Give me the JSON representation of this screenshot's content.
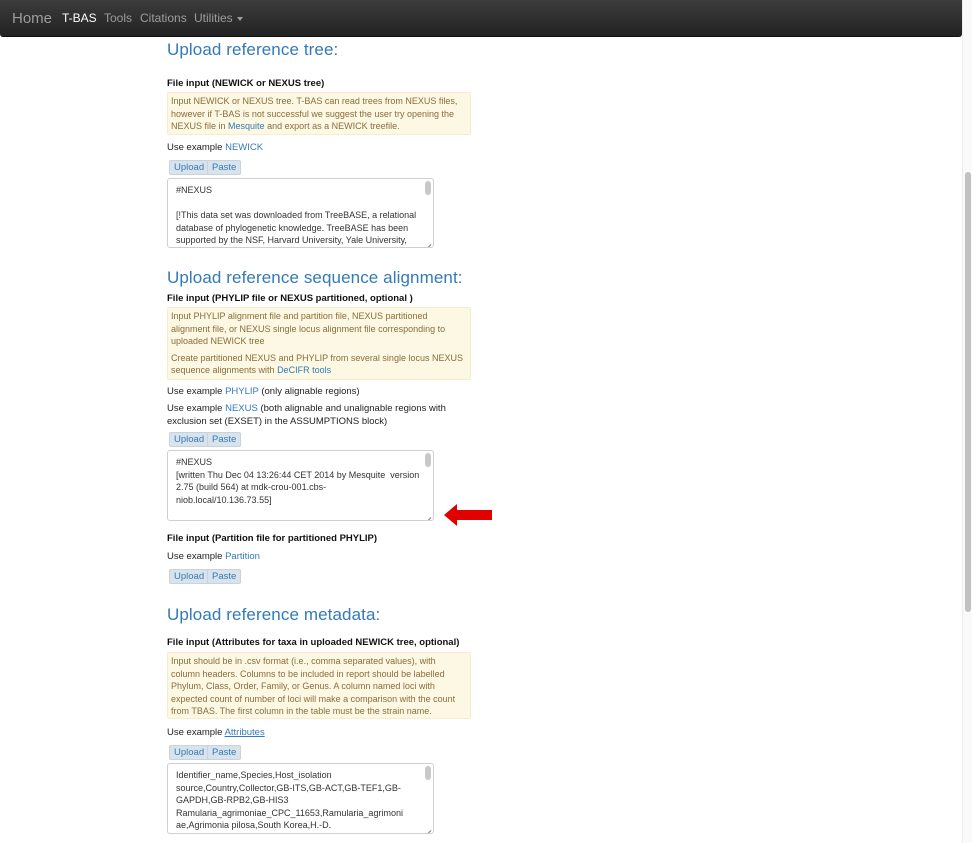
{
  "navbar": {
    "brand": "Home",
    "items": [
      {
        "label": "T-BAS",
        "active": true
      },
      {
        "label": "Tools"
      },
      {
        "label": "Citations"
      },
      {
        "label": "Utilities"
      }
    ]
  },
  "tree": {
    "heading": "Upload reference tree:",
    "label": "File input (NEWICK or NEXUS tree)",
    "note_before_link": "Input NEWICK or NEXUS tree. T-BAS can read trees from NEXUS files, however if T-BAS is not successful we suggest the user try opening the NEXUS file in ",
    "note_link": "Mesquite",
    "note_after_link": " and export as a NEWICK treefile.",
    "example_prefix": "Use example ",
    "example_link": "NEWICK",
    "upload": "Upload",
    "paste": "Paste",
    "textarea": "#NEXUS\n\n[!This data set was downloaded from TreeBASE, a relational database of phylogenetic knowledge. TreeBASE has been supported by the NSF, Harvard University, Yale University, SDSC and UC Davis. Please"
  },
  "alignment": {
    "heading": "Upload reference sequence alignment:",
    "label": "File input (PHYLIP file or NEXUS partitioned, optional )",
    "note_p1": "Input PHYLIP alignment file and partition file, NEXUS partitioned alignment file, or NEXUS single locus alignment file corresponding to uploaded NEWICK tree",
    "note_p2_before": "Create partitioned NEXUS and PHYLIP from several single locus NEXUS sequence alignments with ",
    "note_p2_link": "DeCIFR tools",
    "example1_prefix": "Use example ",
    "example1_link": "PHYLIP",
    "example1_suffix": " (only alignable regions)",
    "example2_prefix": "Use example ",
    "example2_link": "NEXUS",
    "example2_suffix": " (both alignable and unalignable regions with exclusion set (EXSET) in the ASSUMPTIONS block)",
    "upload": "Upload",
    "paste": "Paste",
    "textarea": "#NEXUS\n[written Thu Dec 04 13:26:44 CET 2014 by Mesquite  version 2.75 (build 564) at mdk-crou-001.cbs-niob.local/10.136.73.55]\n\nBEGIN TAXA;"
  },
  "partition": {
    "label": "File input (Partition file for partitioned PHYLIP)",
    "example_prefix": "Use example ",
    "example_link": "Partition",
    "upload": "Upload",
    "paste": "Paste"
  },
  "metadata": {
    "heading": "Upload reference metadata:",
    "label": "File input (Attributes for taxa in uploaded NEWICK tree, optional)",
    "note": "Input should be in .csv format (i.e., comma separated values), with column headers. Columns to be included in report should be labelled Phylum, Class, Order, Family, or Genus. A column named loci with expected count of number of loci will make a comparison with the count from TBAS. The first column in the table must be the strain name.",
    "example_prefix": "Use example ",
    "example_link": "Attributes",
    "upload": "Upload",
    "paste": "Paste",
    "textarea": "Identifier_name,Species,Host_isolation source,Country,Collector,GB-ITS,GB-ACT,GB-TEF1,GB-GAPDH,GB-RPB2,GB-HIS3\nRamularia_agrimoniae_CPC_11653,Ramularia_agrimoni ae,Agrimonia pilosa,South Korea,H.-D."
  },
  "colors": {
    "link": "#337ab7",
    "note_bg": "#fcf8e3",
    "note_text": "#8a6d3b",
    "arrow": "#e00000"
  }
}
